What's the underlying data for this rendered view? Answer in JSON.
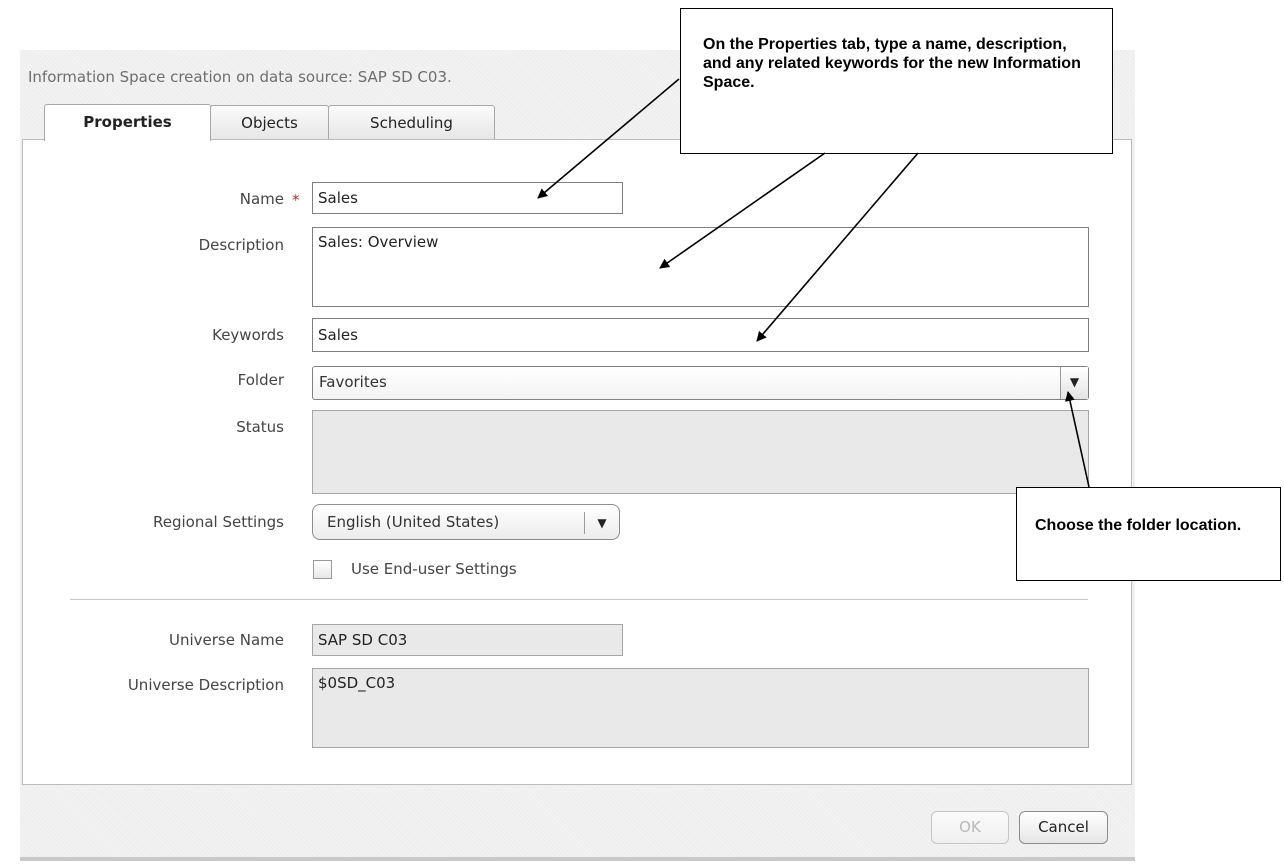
{
  "dialog": {
    "title": "Information Space creation on data source: SAP SD C03."
  },
  "tabs": [
    {
      "label": "Properties",
      "active": true
    },
    {
      "label": "Objects",
      "active": false
    },
    {
      "label": "Scheduling",
      "active": false
    }
  ],
  "form": {
    "name": {
      "label": "Name",
      "value": "Sales",
      "required_marker": "*"
    },
    "description": {
      "label": "Description",
      "value": "Sales: Overview"
    },
    "keywords": {
      "label": "Keywords",
      "value": "Sales"
    },
    "folder": {
      "label": "Folder",
      "value": "Favorites"
    },
    "status": {
      "label": "Status",
      "value": ""
    },
    "regional_settings": {
      "label": "Regional Settings",
      "value": "English (United States)"
    },
    "end_user_settings": {
      "label": "Use End-user Settings",
      "checked": false
    },
    "universe_name": {
      "label": "Universe Name",
      "value": "SAP SD C03"
    },
    "universe_description": {
      "label": "Universe Description",
      "value": "$0SD_C03"
    }
  },
  "buttons": {
    "ok": "OK",
    "cancel": "Cancel"
  },
  "callouts": {
    "properties_tip": "On the Properties tab, type a name, description, and any related keywords for the new Information Space.",
    "folder_tip": "Choose the folder location."
  },
  "icons": {
    "dropdown": "chevron-down-icon",
    "required": "asterisk-icon"
  },
  "colors": {
    "required_marker": "#dd2222",
    "dialog_background": "#f2f2f2",
    "readonly_field": "#e9e9e9"
  }
}
